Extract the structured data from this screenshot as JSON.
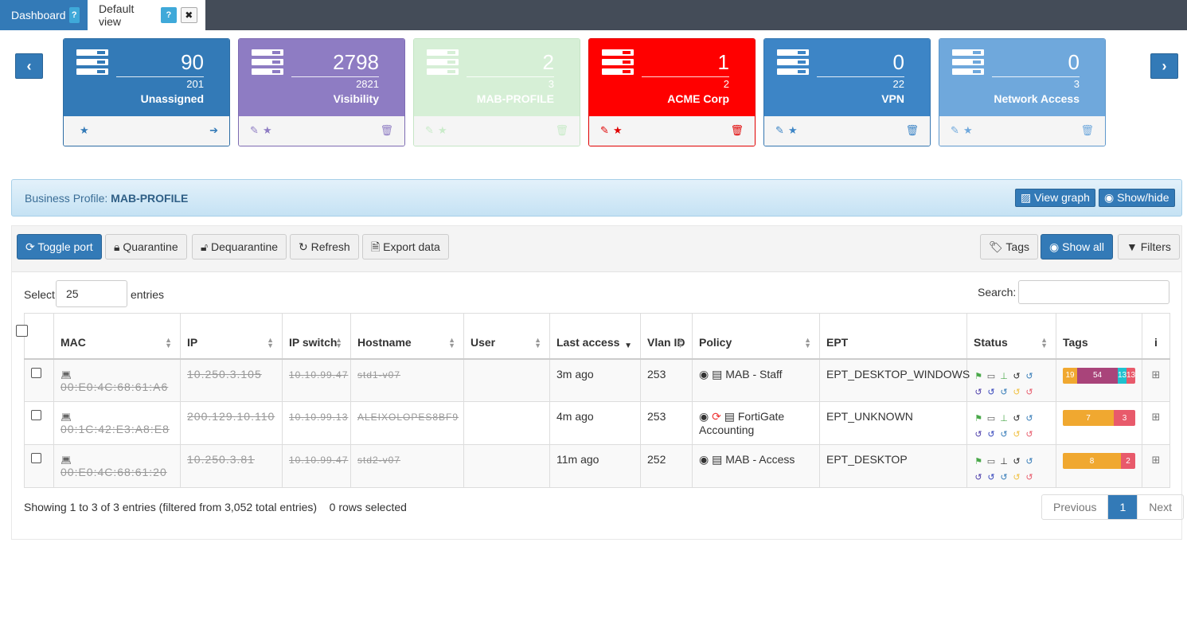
{
  "tabs": [
    {
      "label": "Dashboard",
      "help": "?"
    },
    {
      "label": "Default view",
      "help": "?",
      "close": "✖"
    }
  ],
  "carousel": {
    "prev": "‹",
    "next": "›"
  },
  "cards": [
    {
      "count": "90",
      "total": "201",
      "name": "Unassigned",
      "bg": "#337ab7",
      "border": "#2e6da4",
      "accent": "#337ab7"
    },
    {
      "count": "2798",
      "total": "2821",
      "name": "Visibility",
      "bg": "#8e7cc3",
      "border": "#7d6bb2",
      "accent": "#8e7cc3"
    },
    {
      "count": "2",
      "total": "3",
      "name": "MAB-PROFILE",
      "bg": "#d6efd6",
      "border": "#c5e5c5",
      "accent": "#c9ebc9"
    },
    {
      "count": "1",
      "total": "2",
      "name": "ACME Corp",
      "bg": "#ff0000",
      "border": "#e00000",
      "accent": "#e00000"
    },
    {
      "count": "0",
      "total": "22",
      "name": "VPN",
      "bg": "#3d85c6",
      "border": "#3576b0",
      "accent": "#3d85c6"
    },
    {
      "count": "0",
      "total": "3",
      "name": "Network Access",
      "bg": "#6fa8dc",
      "border": "#5f98cc",
      "accent": "#6fa8dc"
    }
  ],
  "business_profile": {
    "label": "Business Profile:",
    "value": "MAB-PROFILE",
    "view_graph": "View graph",
    "show_hide": "Show/hide"
  },
  "toolbar": {
    "toggle_port": "Toggle port",
    "quarantine": "Quarantine",
    "dequarantine": "Dequarantine",
    "refresh": "Refresh",
    "export": "Export data",
    "tags": "Tags",
    "show_all": "Show all",
    "filters": "Filters"
  },
  "length": {
    "label": "Select",
    "value": "25",
    "after": "entries"
  },
  "search": {
    "label": "Search:",
    "value": ""
  },
  "columns": [
    "MAC",
    "IP",
    "IP switch",
    "Hostname",
    "User",
    "Last access",
    "Vlan ID",
    "Policy",
    "EPT",
    "Status",
    "Tags",
    "i"
  ],
  "rows": [
    {
      "mac": "00:E0:4C:68:61:A6",
      "ip": "10.250.3.105",
      "switch": "10.10.99.47",
      "hostname": "std1-v07",
      "user": "",
      "last": "3m ago",
      "vlan": "253",
      "policy": "MAB - Staff",
      "ept": "EPT_DESKTOP_WINDOWS",
      "tags": [
        {
          "v": "19",
          "c": "#f0a830",
          "w": 18
        },
        {
          "v": "54",
          "c": "#a9447a",
          "w": 51
        },
        {
          "v": "13",
          "c": "#1fc1cf",
          "w": 11
        },
        {
          "v": "13",
          "c": "#e85a6b",
          "w": 11
        }
      ]
    },
    {
      "mac": "00:1C:42:E3:A8:E8",
      "ip": "200.129.10.110",
      "switch": "10.10.99.13",
      "hostname": "ALEIXOLOPES8BF9",
      "user": "",
      "last": "4m ago",
      "vlan": "253",
      "policy": "FortiGate Accounting",
      "ept": "EPT_UNKNOWN",
      "tags": [
        {
          "v": "7",
          "c": "#f0a830",
          "w": 64
        },
        {
          "v": "3",
          "c": "#e85a6b",
          "w": 27
        }
      ]
    },
    {
      "mac": "00:E0:4C:68:61:20",
      "ip": "10.250.3.81",
      "switch": "10.10.99.47",
      "hostname": "std2-v07",
      "user": "",
      "last": "11m ago",
      "vlan": "252",
      "policy": "MAB - Access",
      "ept": "EPT_DESKTOP",
      "tags": [
        {
          "v": "8",
          "c": "#f0a830",
          "w": 73
        },
        {
          "v": "2",
          "c": "#e85a6b",
          "w": 18
        }
      ]
    }
  ],
  "info": {
    "text": "Showing 1 to 3 of 3 entries (filtered from 3,052 total entries)",
    "selected": "0 rows selected"
  },
  "pager": {
    "prev": "Previous",
    "page": "1",
    "next": "Next"
  }
}
